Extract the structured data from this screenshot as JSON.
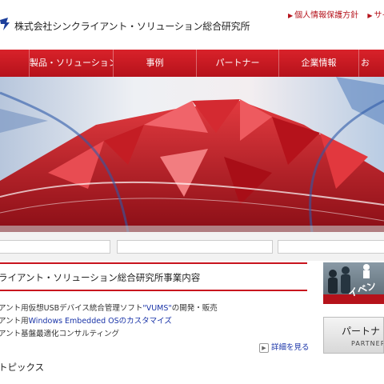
{
  "header": {
    "company_name": "株式会社シンクライアント・ソリューション総合研究所",
    "links": [
      "個人情報保護方針",
      "サイト"
    ]
  },
  "nav": {
    "items": [
      "製品・ソリューション",
      "事例",
      "パートナー",
      "企業情報",
      "お"
    ]
  },
  "main": {
    "heading": "ライアント・ソリューション総合研究所事業内容",
    "business": [
      {
        "pre": "アント用仮想USBデバイス統合管理ソフト",
        "hl": "\"VUMS\"",
        "post": "の開発・販売"
      },
      {
        "pre": "アント用",
        "hl": "Windows Embedded OSのカスタマイズ",
        "post": ""
      },
      {
        "pre": "アント基盤最適化コンサルティング",
        "hl": "",
        "post": ""
      }
    ],
    "detail_link": "詳細を見る",
    "topics_heading": "トピックス"
  },
  "side": {
    "event_label": "イベン",
    "partner_ja": "パートナ",
    "partner_en": "PARTNER"
  },
  "colors": {
    "brand_red": "#c8141e",
    "link_blue": "#1a34a8",
    "logo_blue": "#1d3f9b"
  }
}
